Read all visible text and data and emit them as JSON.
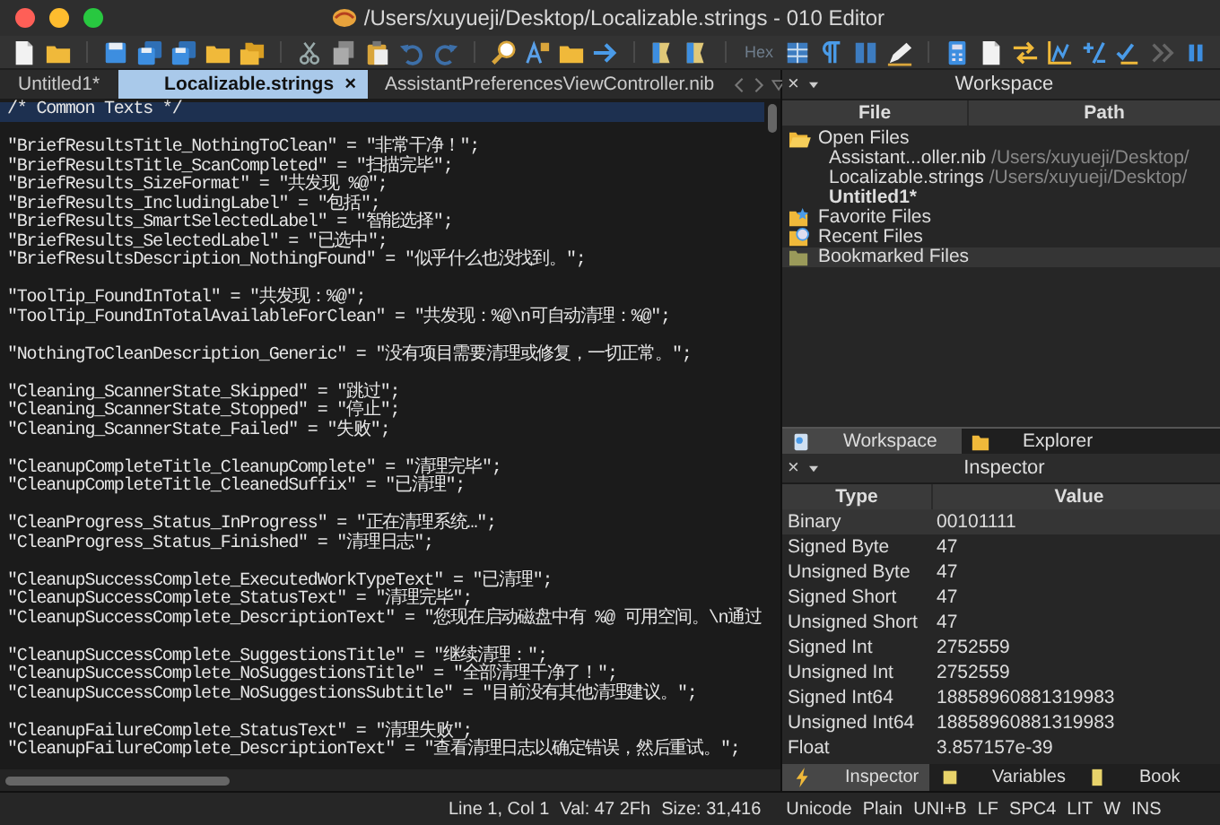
{
  "window": {
    "title": "/Users/xuyueji/Desktop/Localizable.strings - 010 Editor"
  },
  "toolbar": {
    "hex_label": "Hex"
  },
  "tabs": [
    {
      "label": "Untitled1*",
      "selected": false
    },
    {
      "label": "Localizable.strings",
      "selected": true,
      "close": "×"
    },
    {
      "label": "AssistantPreferencesViewController.nib",
      "selected": false
    }
  ],
  "editor": {
    "blocks": [
      {
        "lines": [
          {
            "text": "/* Common Texts */",
            "current": true
          }
        ]
      },
      {
        "lines": [
          {
            "text": "\"BriefResultsTitle_NothingToClean\" = \"非常干净！\";",
            "current": false
          },
          {
            "text": "\"BriefResultsTitle_ScanCompleted\" = \"扫描完毕\";",
            "current": false
          },
          {
            "text": "\"BriefResults_SizeFormat\" = \"共发现 %@\";",
            "current": false
          },
          {
            "text": "\"BriefResults_IncludingLabel\" = \"包括\";",
            "current": false
          },
          {
            "text": "\"BriefResults_SmartSelectedLabel\" = \"智能选择\";",
            "current": false
          },
          {
            "text": "\"BriefResults_SelectedLabel\" = \"已选中\";",
            "current": false
          },
          {
            "text": "\"BriefResultsDescription_NothingFound\" = \"似乎什么也没找到。\";",
            "current": false
          }
        ]
      },
      {
        "lines": [
          {
            "text": "\"ToolTip_FoundInTotal\" = \"共发现：%@\";",
            "current": false
          },
          {
            "text": "\"ToolTip_FoundInTotalAvailableForClean\" = \"共发现：%@\\n可自动清理：%@\";",
            "current": false
          }
        ]
      },
      {
        "lines": [
          {
            "text": "\"NothingToCleanDescription_Generic\" = \"没有项目需要清理或修复，一切正常。\";",
            "current": false
          }
        ]
      },
      {
        "lines": [
          {
            "text": "\"Cleaning_ScannerState_Skipped\" = \"跳过\";",
            "current": false
          },
          {
            "text": "\"Cleaning_ScannerState_Stopped\" = \"停止\";",
            "current": false
          },
          {
            "text": "\"Cleaning_ScannerState_Failed\" = \"失败\";",
            "current": false
          }
        ]
      },
      {
        "lines": [
          {
            "text": "\"CleanupCompleteTitle_CleanupComplete\" = \"清理完毕\";",
            "current": false
          },
          {
            "text": "\"CleanupCompleteTitle_CleanedSuffix\" = \"已清理\";",
            "current": false
          }
        ]
      },
      {
        "lines": [
          {
            "text": "\"CleanProgress_Status_InProgress\" = \"正在清理系统…\";",
            "current": false
          },
          {
            "text": "\"CleanProgress_Status_Finished\" = \"清理日志\";",
            "current": false
          }
        ]
      },
      {
        "lines": [
          {
            "text": "\"CleanupSuccessComplete_ExecutedWorkTypeText\" = \"已清理\";",
            "current": false
          },
          {
            "text": "\"CleanupSuccessComplete_StatusText\" = \"清理完毕\";",
            "current": false
          },
          {
            "text": "\"CleanupSuccessComplete_DescriptionText\" = \"您现在启动磁盘中有 %@ 可用空间。\\n通过",
            "current": false
          }
        ]
      },
      {
        "lines": [
          {
            "text": "\"CleanupSuccessComplete_SuggestionsTitle\" = \"继续清理：\";",
            "current": false
          },
          {
            "text": "\"CleanupSuccessComplete_NoSuggestionsTitle\" = \"全部清理干净了！\";",
            "current": false
          },
          {
            "text": "\"CleanupSuccessComplete_NoSuggestionsSubtitle\" = \"目前没有其他清理建议。\";",
            "current": false
          }
        ]
      },
      {
        "lines": [
          {
            "text": "\"CleanupFailureComplete_StatusText\" = \"清理失败\";",
            "current": false
          },
          {
            "text": "\"CleanupFailureComplete_DescriptionText\" = \"查看清理日志以确定错误，然后重试。\";",
            "current": false
          }
        ]
      }
    ]
  },
  "workspace": {
    "close": "×",
    "title": "Workspace",
    "columns": [
      "File",
      "Path"
    ],
    "groups": [
      {
        "kind": "open",
        "label": "Open Files",
        "selected": false,
        "children": [
          {
            "file": "Assistant...oller.nib",
            "path": "/Users/xuyueji/Desktop/",
            "modified": false,
            "selected": false
          },
          {
            "file": "Localizable.strings",
            "path": "/Users/xuyueji/Desktop/",
            "modified": false,
            "selected": false
          },
          {
            "file": "Untitled1*",
            "modified": true,
            "selected": false
          }
        ]
      },
      {
        "kind": "favorite",
        "label": "Favorite Files",
        "selected": false
      },
      {
        "kind": "recent",
        "label": "Recent Files",
        "selected": false
      },
      {
        "kind": "bookmarked",
        "label": "Bookmarked Files",
        "selected": true
      }
    ]
  },
  "panel_tabs": [
    {
      "kind": "workspace",
      "label": "Workspace",
      "selected": true
    },
    {
      "kind": "explorer",
      "label": "Explorer",
      "selected": false
    }
  ],
  "inspector": {
    "close": "×",
    "title": "Inspector",
    "columns": [
      "Type",
      "Value"
    ],
    "rows": [
      {
        "type": "Binary",
        "value": "00101111",
        "selected": true
      },
      {
        "type": "Signed Byte",
        "value": "47",
        "selected": false
      },
      {
        "type": "Unsigned Byte",
        "value": "47",
        "selected": false
      },
      {
        "type": "Signed Short",
        "value": "47",
        "selected": false
      },
      {
        "type": "Unsigned Short",
        "value": "47",
        "selected": false
      },
      {
        "type": "Signed Int",
        "value": "2752559",
        "selected": false
      },
      {
        "type": "Unsigned Int",
        "value": "2752559",
        "selected": false
      },
      {
        "type": "Signed Int64",
        "value": "18858960881319983",
        "selected": false
      },
      {
        "type": "Unsigned Int64",
        "value": "18858960881319983",
        "selected": false
      },
      {
        "type": "Float",
        "value": "3.857157e-39",
        "selected": false
      }
    ]
  },
  "bottom_tabs": [
    {
      "kind": "inspector",
      "label": "Inspector",
      "selected": true
    },
    {
      "kind": "variables",
      "label": "Variables",
      "selected": false
    },
    {
      "kind": "bookmarks",
      "label": "Book",
      "selected": false
    }
  ],
  "status_bar": {
    "left": [
      "Line 1, Col 1",
      "Val: 47 2Fh",
      "Size: 31,416"
    ],
    "right": [
      "Unicode",
      "Plain",
      "UNI+B",
      "LF",
      "SPC4",
      "LIT",
      "W",
      "INS"
    ]
  }
}
